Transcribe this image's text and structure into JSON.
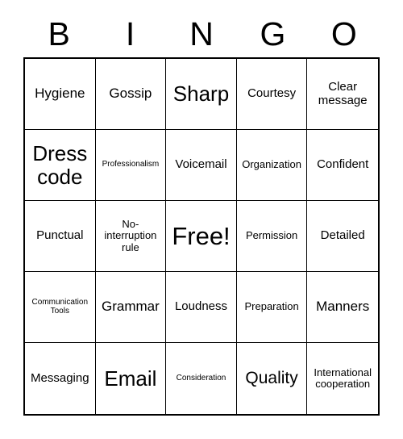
{
  "header": {
    "letters": [
      "B",
      "I",
      "N",
      "G",
      "O"
    ]
  },
  "grid": {
    "columns": 5,
    "rows": 5,
    "cells": [
      {
        "text": "Hygiene",
        "size": "fs-l"
      },
      {
        "text": "Gossip",
        "size": "fs-l"
      },
      {
        "text": "Sharp",
        "size": "fs-xxl"
      },
      {
        "text": "Courtesy",
        "size": "fs-m"
      },
      {
        "text": "Clear message",
        "size": "fs-m"
      },
      {
        "text": "Dress code",
        "size": "fs-xxl"
      },
      {
        "text": "Professionalism",
        "size": "fs-xs"
      },
      {
        "text": "Voicemail",
        "size": "fs-m"
      },
      {
        "text": "Organization",
        "size": "fs-s"
      },
      {
        "text": "Confident",
        "size": "fs-m"
      },
      {
        "text": "Punctual",
        "size": "fs-m"
      },
      {
        "text": "No-interruption rule",
        "size": "fs-s"
      },
      {
        "text": "Free!",
        "size": "fs-huge"
      },
      {
        "text": "Permission",
        "size": "fs-s"
      },
      {
        "text": "Detailed",
        "size": "fs-m"
      },
      {
        "text": "Communication Tools",
        "size": "fs-xs"
      },
      {
        "text": "Grammar",
        "size": "fs-l"
      },
      {
        "text": "Loudness",
        "size": "fs-m"
      },
      {
        "text": "Preparation",
        "size": "fs-s"
      },
      {
        "text": "Manners",
        "size": "fs-l"
      },
      {
        "text": "Messaging",
        "size": "fs-m"
      },
      {
        "text": "Email",
        "size": "fs-xxl"
      },
      {
        "text": "Consideration",
        "size": "fs-xs"
      },
      {
        "text": "Quality",
        "size": "fs-xl"
      },
      {
        "text": "International cooperation",
        "size": "fs-s"
      }
    ]
  },
  "colors": {
    "background": "#ffffff",
    "text": "#000000",
    "grid_line": "#000000"
  }
}
